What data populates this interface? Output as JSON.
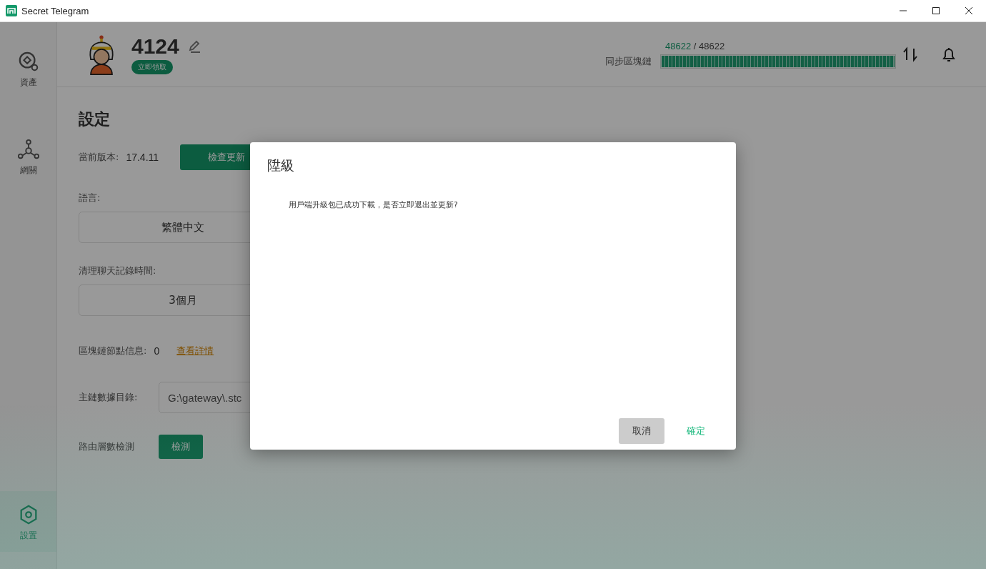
{
  "window": {
    "title": "Secret Telegram"
  },
  "sidebar": {
    "items": [
      {
        "label": "資產",
        "kind": "coin",
        "selected": false
      },
      {
        "label": "網關",
        "kind": "network",
        "selected": false
      },
      {
        "label": "設置",
        "kind": "hexagon",
        "selected": true
      }
    ]
  },
  "profile": {
    "name": "4124",
    "badge": "立即領取"
  },
  "sync": {
    "current": "48622",
    "separator": "/",
    "total": "48622",
    "label": "同步區塊鏈",
    "level": 1
  },
  "settings": {
    "title": "設定",
    "version_label": "當前版本:",
    "version": "17.4.11",
    "check_button": "檢查更新",
    "language_label": "語言:",
    "language": "繁體中文",
    "clear_label": "清理聊天記錄時間:",
    "clear_value": "3個月",
    "node_label": "區塊鏈節點信息:",
    "node_count": "0",
    "node_link": "查看詳情",
    "dir_label": "主鏈數據目錄:",
    "dir_value": "G:\\gateway\\.stc",
    "route_label": "路由層數檢測",
    "route_button": "檢測"
  },
  "dialog": {
    "title": "陞級",
    "message": "用戶端升級包已成功下載，是否立即退出並更新?",
    "cancel": "取消",
    "confirm": "確定"
  }
}
